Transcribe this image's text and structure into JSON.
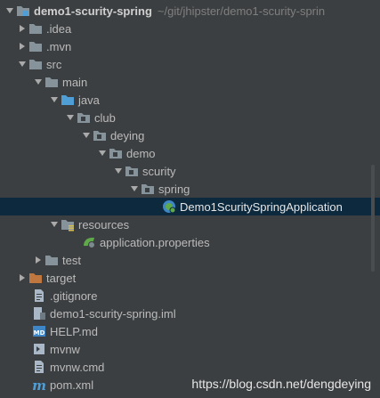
{
  "root": {
    "name": "demo1-scurity-spring",
    "path": "~/git/jhipster/demo1-scurity-sprin"
  },
  "items": [
    {
      "label": ".idea"
    },
    {
      "label": ".mvn"
    },
    {
      "label": "src"
    },
    {
      "label": "main"
    },
    {
      "label": "java"
    },
    {
      "label": "club"
    },
    {
      "label": "deying"
    },
    {
      "label": "demo"
    },
    {
      "label": "scurity"
    },
    {
      "label": "spring"
    },
    {
      "label": "Demo1ScuritySpringApplication"
    },
    {
      "label": "resources"
    },
    {
      "label": "application.properties"
    },
    {
      "label": "test"
    },
    {
      "label": "target"
    },
    {
      "label": ".gitignore"
    },
    {
      "label": "demo1-scurity-spring.iml"
    },
    {
      "label": "HELP.md"
    },
    {
      "label": "mvnw"
    },
    {
      "label": "mvnw.cmd"
    },
    {
      "label": "pom.xml"
    }
  ],
  "watermark": "https://blog.csdn.net/dengdeying",
  "colors": {
    "background": "#3c3f41",
    "selection": "#0d293e",
    "folder": "#87939a",
    "source_folder": "#4f9ed6",
    "target_folder": "#c0773f",
    "spring_green": "#5fa94a"
  }
}
